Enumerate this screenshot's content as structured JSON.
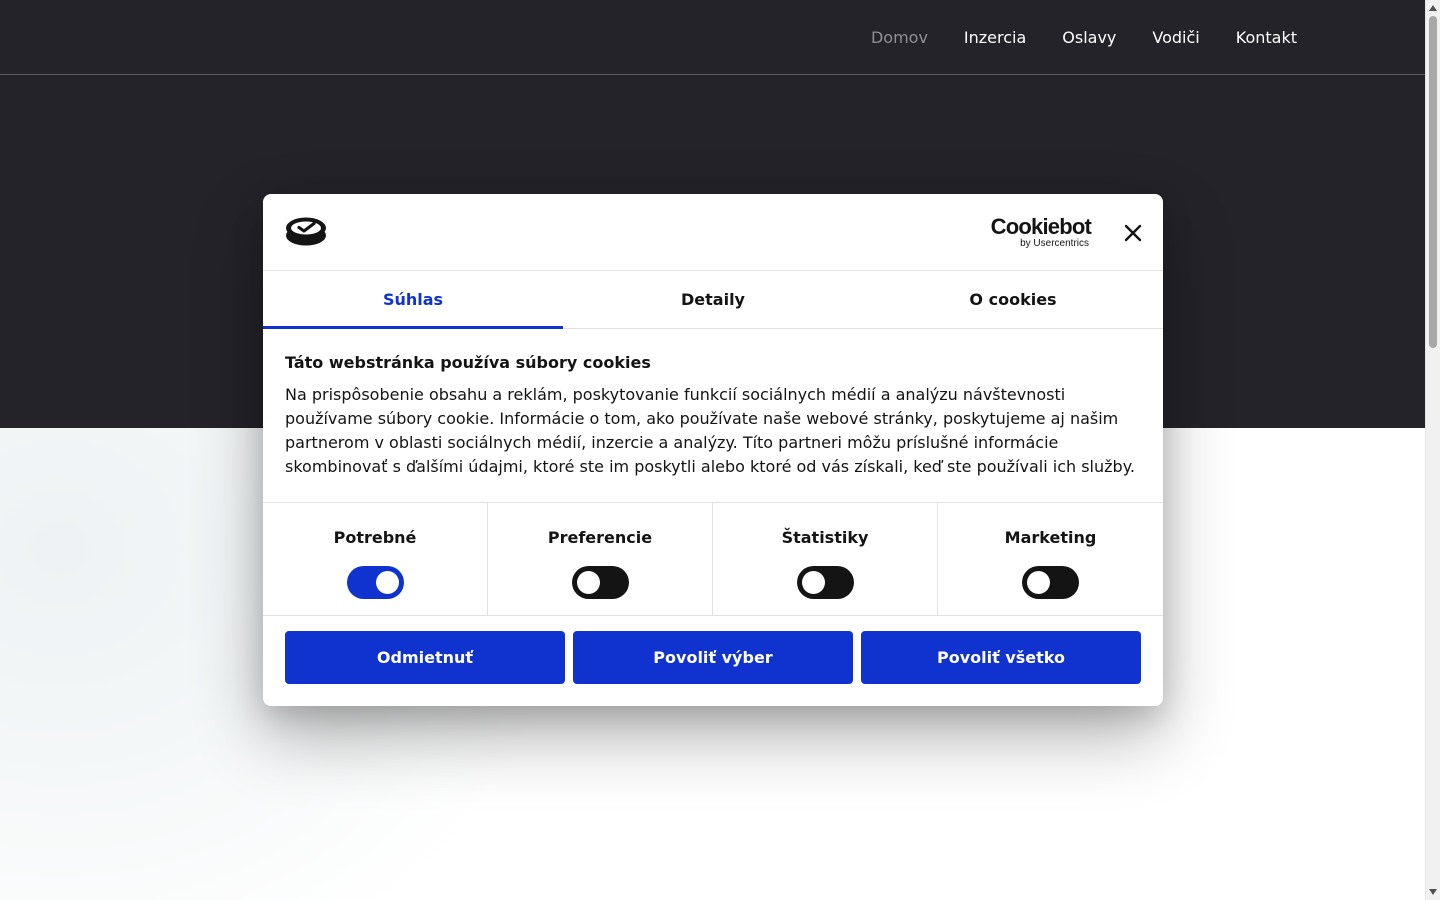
{
  "nav": {
    "items": [
      "Domov",
      "Inzercia",
      "Oslavy",
      "Vodiči",
      "Kontakt"
    ],
    "active": "Domov"
  },
  "dialog": {
    "brand": {
      "name": "Cookiebot",
      "sub": "by Usercentrics"
    },
    "tabs": [
      {
        "label": "Súhlas",
        "active": true
      },
      {
        "label": "Detaily",
        "active": false
      },
      {
        "label": "O cookies",
        "active": false
      }
    ],
    "title": "Táto webstránka používa súbory cookies",
    "text": "Na prispôsobenie obsahu a reklám, poskytovanie funkcií sociálnych médií a analýzu návštevnosti používame súbory cookie. Informácie o tom, ako používate naše webové stránky, poskytujeme aj našim partnerom v oblasti sociálnych médií, inzercie a analýzy. Títo partneri môžu príslušné informácie skombinovať s ďalšími údajmi, ktoré ste im poskytli alebo ktoré od vás získali, keď ste používali ich služby.",
    "toggles": [
      {
        "label": "Potrebné",
        "on": true
      },
      {
        "label": "Preferencie",
        "on": false
      },
      {
        "label": "Štatistiky",
        "on": false
      },
      {
        "label": "Marketing",
        "on": false
      }
    ],
    "buttons": {
      "deny": "Odmietnuť",
      "allow_selection": "Povoliť výber",
      "allow_all": "Povoliť všetko"
    }
  },
  "colors": {
    "header_bg": "#24232a",
    "accent": "#1032cf",
    "nav_active": "#8f8f94"
  },
  "icons": {
    "logo": "cookiebot-logo-icon",
    "close": "close-icon"
  }
}
